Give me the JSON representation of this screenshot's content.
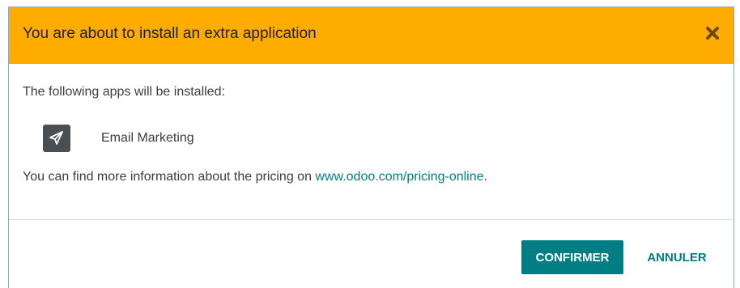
{
  "dialog": {
    "title": "You are about to install an extra application",
    "header_color": "#ffac00",
    "close_icon": "close-icon"
  },
  "body": {
    "intro": "The following apps will be installed:",
    "apps": [
      {
        "name": "Email Marketing",
        "icon": "paper-plane-icon"
      }
    ],
    "pricing_prefix": "You can find more information about the pricing on ",
    "pricing_link": "www.odoo.com/pricing-online",
    "pricing_suffix": "."
  },
  "footer": {
    "confirm_label": "CONFIRMER",
    "cancel_label": "ANNULER",
    "accent_color": "#017e84"
  }
}
